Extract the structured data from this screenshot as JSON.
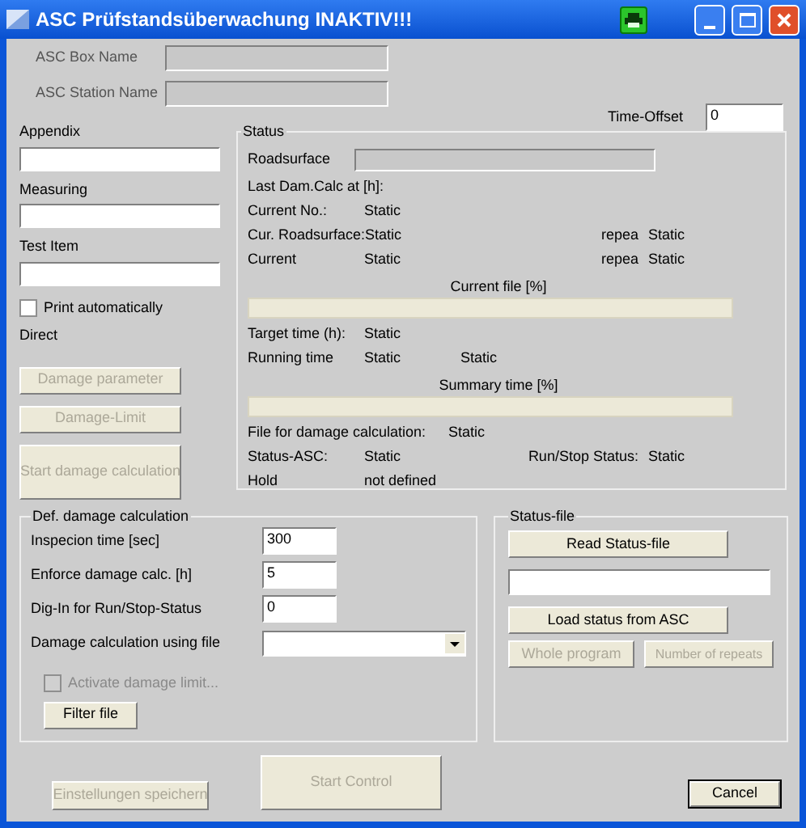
{
  "window": {
    "title": "ASC Prüfstandsüberwachung INAKTIV!!!"
  },
  "header_fields": [
    {
      "label": "ASC Box Name",
      "disabled": true
    },
    {
      "label": "ASC Station Name",
      "disabled": true
    }
  ],
  "time_offset": {
    "label": "Time-Offset",
    "value": "0"
  },
  "left_fields": [
    {
      "label": "Appendix"
    },
    {
      "label": "Measuring"
    },
    {
      "label": "Test Item"
    }
  ],
  "print_automatically": {
    "label": "Print automatically",
    "checked": false
  },
  "direct_label": "Direct",
  "left_buttons": [
    {
      "label": "Damage parameter",
      "disabled": true,
      "kind": "small"
    },
    {
      "label": "Damage-Limit",
      "disabled": true,
      "kind": "small"
    },
    {
      "label": "Start damage calculation",
      "disabled": true,
      "kind": "large"
    }
  ],
  "status": {
    "title": "Status",
    "rows": [
      {
        "kind": "field",
        "label": "Roadsurface"
      },
      {
        "kind": "pair",
        "label": "Last Dam.Calc at [h]:"
      },
      {
        "kind": "pair",
        "label": "Current No.:",
        "value": "Static"
      },
      {
        "kind": "pair",
        "label": "Cur. Roadsurface:",
        "value": "Static",
        "extra_label": "repea",
        "extra_value": "Static"
      },
      {
        "kind": "pair",
        "label": "Current",
        "value": "Static",
        "extra_label": "repea",
        "extra_value": "Static"
      },
      {
        "kind": "progress",
        "label": "Current file [%]",
        "level": 0
      },
      {
        "kind": "pair",
        "label": "Target time (h):",
        "value": "Static"
      },
      {
        "kind": "pair",
        "label": "Running time",
        "value": "Static",
        "value_2": "Static"
      },
      {
        "kind": "progress",
        "label": "Summary time [%]",
        "level": 0
      },
      {
        "kind": "wide",
        "label": "File for damage calculation:",
        "value": "Static"
      },
      {
        "kind": "pair",
        "label": "Status-ASC:",
        "value": "Static",
        "extra_label": "Run/Stop Status:",
        "extra_value": "Static"
      },
      {
        "kind": "pair",
        "label": "Hold",
        "value": "not defined"
      }
    ]
  },
  "damage_calc": {
    "title": "Def. damage calculation",
    "fields": [
      {
        "kind": "input",
        "label": "Inspecion time  [sec]",
        "value": "300"
      },
      {
        "kind": "input",
        "label": "Enforce damage calc. [h]",
        "value": "5"
      },
      {
        "kind": "input",
        "label": "Dig-In for Run/Stop-Status",
        "value": "0"
      },
      {
        "kind": "dropdown",
        "label": "Damage calculation using file"
      }
    ],
    "activate_limit": {
      "label": "Activate damage limit...",
      "checked": false,
      "disabled": true
    },
    "filter_button": {
      "label": "Filter file",
      "disabled": false
    }
  },
  "status_file": {
    "title": "Status-file",
    "read_button": {
      "label": "Read Status-file",
      "disabled": false
    },
    "load_button": {
      "label": "Load status from ASC",
      "disabled": false
    },
    "small_buttons": [
      {
        "label": "Whole program",
        "disabled": true
      },
      {
        "label": "Number of repeats",
        "disabled": true
      }
    ]
  },
  "footer_buttons": [
    {
      "label": "Einstellungen speichern",
      "disabled": true,
      "kind": "save"
    },
    {
      "label": "Start Control",
      "disabled": true,
      "kind": "start"
    },
    {
      "label": "Cancel",
      "disabled": false,
      "kind": "cancel"
    }
  ]
}
